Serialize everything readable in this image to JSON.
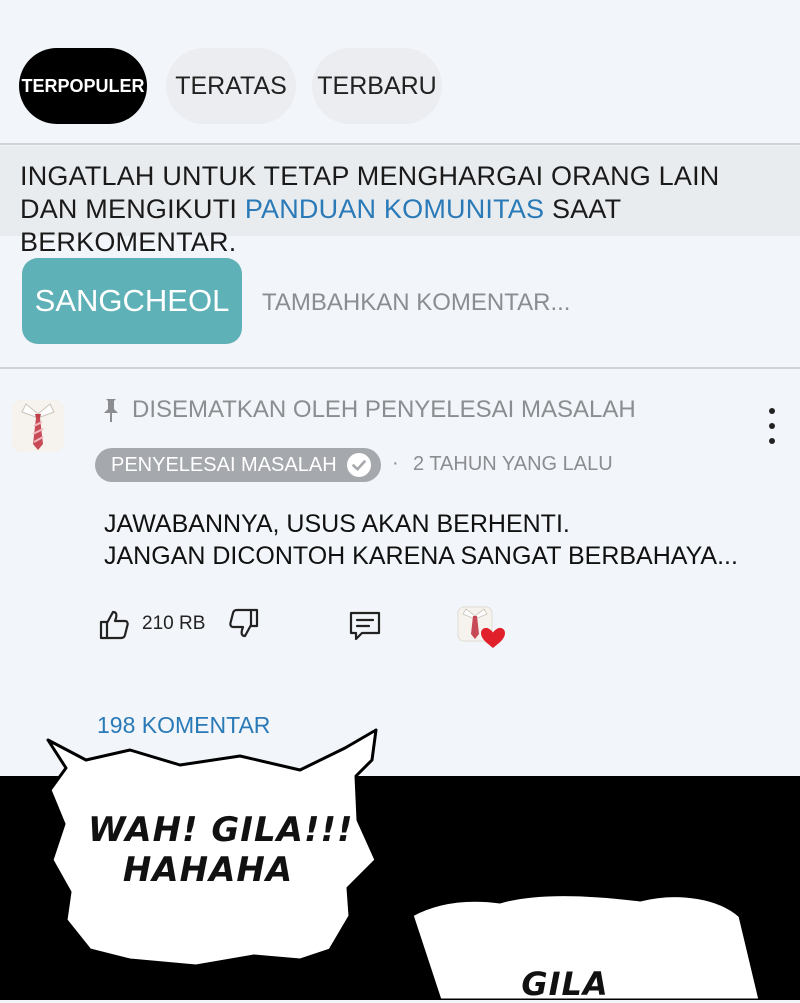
{
  "tabs": [
    {
      "label": "TERPOPULER",
      "active": true
    },
    {
      "label": "TERATAS",
      "active": false
    },
    {
      "label": "TERBARU",
      "active": false
    }
  ],
  "notice": {
    "text_before": "INGATLAH UNTUK TETAP MENGHARGAI ORANG LAIN DAN MENGIKUTI ",
    "link": "PANDUAN KOMUNITAS",
    "text_after": " SAAT BERKOMENTAR."
  },
  "compose": {
    "username": "SANGCHEOL",
    "placeholder": "TAMBAHKAN KOMENTAR..."
  },
  "comment": {
    "pinned_label": "DISEMATKAN OLEH PENYELESAI MASALAH",
    "author_badge": "PENYELESAI MASALAH",
    "dot": "·",
    "time": "2 TAHUN YANG LALU",
    "body": "JAWABANNYA, USUS AKAN BERHENTI.\nJANGAN DICONTOH KARENA SANGAT BERBAHAYA...",
    "likes": "210 RB",
    "replies": "198 KOMENTAR"
  },
  "comic": {
    "bubble_left": "WAH! GILA!!!\nHAHAHA",
    "bubble_right": "GILA"
  },
  "colors": {
    "accent_link": "#2a7ab8",
    "user_chip": "#5eb1b6",
    "heart": "#e0202a",
    "badge": "#a5a8ad"
  },
  "icons": [
    "pin-icon",
    "kebab-menu-icon",
    "verified-check-icon",
    "thumbs-up-icon",
    "thumbs-down-icon",
    "reply-icon",
    "creator-heart-icon"
  ]
}
